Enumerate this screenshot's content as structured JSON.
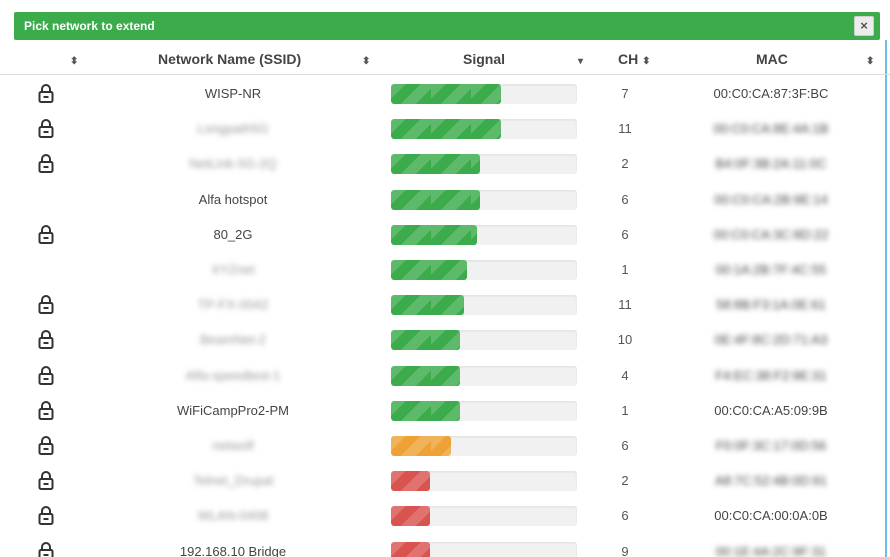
{
  "dialog": {
    "title": "Pick network to extend",
    "close_label": "×",
    "accent_color": "#3bab4b"
  },
  "columns": {
    "lock": {
      "sort_icon": "⬍"
    },
    "ssid": {
      "label": "Network Name (SSID)",
      "sort_icon": "⬍"
    },
    "signal": {
      "label": "Signal",
      "sort_icon": "▾"
    },
    "ch": {
      "label": "CH",
      "sort_icon": "⬍"
    },
    "mac": {
      "label": "MAC",
      "sort_icon": "⬍"
    }
  },
  "networks": [
    {
      "locked": true,
      "ssid": "WISP-NR",
      "ssid_blurred": false,
      "signal": 0.59,
      "level": "green",
      "ch": "7",
      "mac": "00:C0:CA:87:3F:BC",
      "mac_blurred": false
    },
    {
      "locked": true,
      "ssid": "Longpath5G",
      "ssid_blurred": true,
      "signal": 0.59,
      "level": "green",
      "ch": "11",
      "mac": "00:C0:CA:8E:4A:1B",
      "mac_blurred": true
    },
    {
      "locked": true,
      "ssid": "NetLink-5G-2Q",
      "ssid_blurred": true,
      "signal": 0.48,
      "level": "green",
      "ch": "2",
      "mac": "B4:0F:3B:2A:11:0C",
      "mac_blurred": true
    },
    {
      "locked": false,
      "ssid": "Alfa hotspot",
      "ssid_blurred": false,
      "signal": 0.48,
      "level": "green",
      "ch": "6",
      "mac": "00:C0:CA:2B:9E:14",
      "mac_blurred": true
    },
    {
      "locked": true,
      "ssid": "80_2G",
      "ssid_blurred": false,
      "signal": 0.46,
      "level": "green",
      "ch": "6",
      "mac": "00:C0:CA:3C:8D:22",
      "mac_blurred": true
    },
    {
      "locked": false,
      "ssid": "XYZnet",
      "ssid_blurred": true,
      "signal": 0.41,
      "level": "green",
      "ch": "1",
      "mac": "00:1A:2B:7F:4C:55",
      "mac_blurred": true
    },
    {
      "locked": true,
      "ssid": "TP-FX-0042",
      "ssid_blurred": true,
      "signal": 0.39,
      "level": "green",
      "ch": "11",
      "mac": "58:8B:F3:1A:0E:61",
      "mac_blurred": true
    },
    {
      "locked": true,
      "ssid": "BeamNet-2",
      "ssid_blurred": true,
      "signal": 0.37,
      "level": "green",
      "ch": "10",
      "mac": "0E:4F:8C:2D:71:A3",
      "mac_blurred": true
    },
    {
      "locked": true,
      "ssid": "Alfa-speedtest-1",
      "ssid_blurred": true,
      "signal": 0.37,
      "level": "green",
      "ch": "4",
      "mac": "F4:EC:38:F2:9E:31",
      "mac_blurred": true
    },
    {
      "locked": true,
      "ssid": "WiFiCampPro2-PM",
      "ssid_blurred": false,
      "signal": 0.37,
      "level": "green",
      "ch": "1",
      "mac": "00:C0:CA:A5:09:9B",
      "mac_blurred": false
    },
    {
      "locked": true,
      "ssid": "netwolf",
      "ssid_blurred": true,
      "signal": 0.32,
      "level": "orange",
      "ch": "6",
      "mac": "F0:0F:3C:17:0D:56",
      "mac_blurred": true
    },
    {
      "locked": true,
      "ssid": "Telnet_Drupal",
      "ssid_blurred": true,
      "signal": 0.21,
      "level": "red",
      "ch": "2",
      "mac": "A8:7C:52:4B:0D:91",
      "mac_blurred": true
    },
    {
      "locked": true,
      "ssid": "WLAN-0408",
      "ssid_blurred": true,
      "signal": 0.21,
      "level": "red",
      "ch": "6",
      "mac": "00:C0:CA:00:0A:0B",
      "mac_blurred": false
    },
    {
      "locked": true,
      "ssid": "192.168.10 Bridge",
      "ssid_blurred": false,
      "signal": 0.21,
      "level": "red",
      "ch": "9",
      "mac": "00:1E:4A:2C:9F:31",
      "mac_blurred": true
    }
  ]
}
